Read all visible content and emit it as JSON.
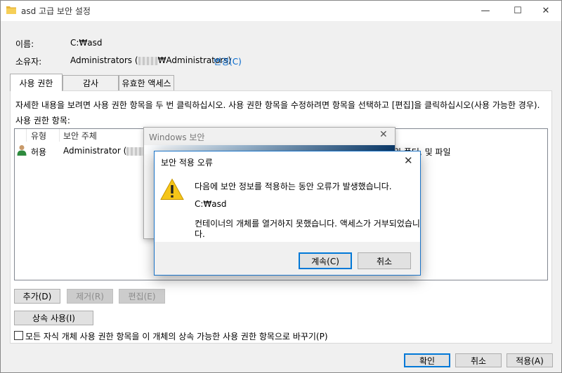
{
  "window": {
    "title": "asd 고급 보안 설정",
    "minimize_glyph": "—",
    "maximize_glyph": "☐",
    "close_glyph": "✕"
  },
  "info": {
    "name_label": "이름:",
    "name_value": "C:₩asd",
    "owner_label": "소유자:",
    "owner_prefix": "Administrators (",
    "owner_suffix": "₩Administrators)",
    "change_link": "변경(C)"
  },
  "tabs": [
    {
      "label": "사용 권한",
      "active": true
    },
    {
      "label": "감사",
      "active": false
    },
    {
      "label": "유효한 액세스",
      "active": false
    }
  ],
  "permissions": {
    "instruction": "자세한 내용을 보려면 사용 권한 항목을 두 번 클릭하십시오. 사용 권한 항목을 수정하려면 항목을 선택하고 [편집]을 클릭하십시오(사용 가능한 경우).",
    "entries_label": "사용 권한 항목:",
    "columns": [
      "유형",
      "보안 주체"
    ],
    "rows": [
      {
        "type": "허용",
        "principal": "Administrator (",
        "applies_to_tail": "위 폴더, 및 파일"
      }
    ]
  },
  "buttons": {
    "add": "추가(D)",
    "remove": "제거(R)",
    "edit": "편집(E)",
    "inheritance": "상속 사용(I)",
    "ok": "확인",
    "cancel": "취소",
    "apply": "적용(A)"
  },
  "replace_checkbox": {
    "label": "모든 자식 개체 사용 권한 항목을 이 개체의 상속 가능한 사용 권한 항목으로 바꾸기(P)",
    "checked": false
  },
  "security_dialog": {
    "title": "Windows 보안",
    "close_glyph": "✕"
  },
  "error_dialog": {
    "title": "보안 적용 오류",
    "close_glyph": "✕",
    "message_line1": "다음에 보안 정보를 적용하는 동안 오류가 발생했습니다.",
    "path": "C:₩asd",
    "message_line2a": "컨테이너의 개체를 열거하지 못했습니다. 액세스가 거부되었습니",
    "message_line2b": "다.",
    "continue_button": "계속(C)",
    "cancel_button": "취소"
  },
  "colors": {
    "accent": "#0078d7",
    "link": "#0066cc",
    "warning": "#f5c518"
  }
}
